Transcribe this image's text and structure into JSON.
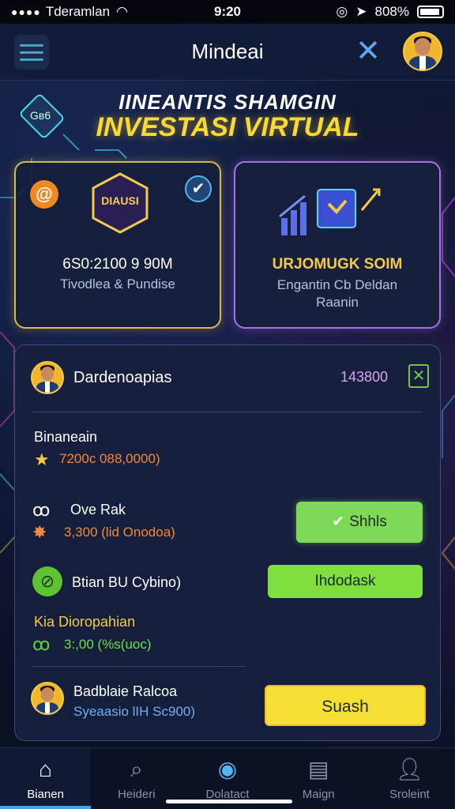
{
  "status_bar": {
    "carrier": "Tderamlan",
    "time": "9:20",
    "battery": "808%"
  },
  "header": {
    "title": "Mindeai",
    "close_glyph": "✕",
    "menu_icon": "hamburger-icon"
  },
  "hero": {
    "subtitle": "IINEANTIS SHAMGIN",
    "title": "INVESTASI VIRTUAL",
    "chip_label": "Gʙ6"
  },
  "cards": [
    {
      "badge": "DIAUSI",
      "amount": "6S0:2100 9 90M",
      "description": "Tivodlea & Pundise",
      "accent": "#d6b74a"
    },
    {
      "amount": "URJOMUGK SOIM",
      "description": "Engantin Cb Deldan Raanin",
      "accent": "#a671e6"
    }
  ],
  "panel": {
    "user_name": "Dardenoapias",
    "balance": "143800",
    "close_glyph": "✕",
    "rows": [
      {
        "title": "Binaneain",
        "value": "7200c 088,0000)",
        "value_prefix_icon": "star-icon"
      },
      {
        "title": "Ove Rak",
        "value": "3,300 (lid Onodoa)",
        "value_prefix_icon": "splat-icon",
        "button": "Shhls"
      },
      {
        "title": "Btian BU Cybino)",
        "button": "Ihdodask"
      },
      {
        "title": "Kia Dioropahian",
        "value": "3:,00 (%s(uoc)",
        "value_prefix_icon": "link-icon"
      },
      {
        "title": "Badblaie Ralcoa",
        "value": "Syeaasio lIH Sc900)",
        "button": "Suash"
      }
    ]
  },
  "bottom_nav": [
    {
      "label": "Bianen",
      "icon": "home-icon",
      "active": true
    },
    {
      "label": "Heideri",
      "icon": "search-icon",
      "active": false
    },
    {
      "label": "Dolatact",
      "icon": "scan-icon",
      "active": false
    },
    {
      "label": "Maign",
      "icon": "news-icon",
      "active": false
    },
    {
      "label": "Sroleint",
      "icon": "user-icon",
      "active": false
    }
  ],
  "colors": {
    "gold": "#f9d936",
    "green_button": "#7ed957",
    "yellow_button": "#f7e036",
    "purple": "#a671e6"
  }
}
